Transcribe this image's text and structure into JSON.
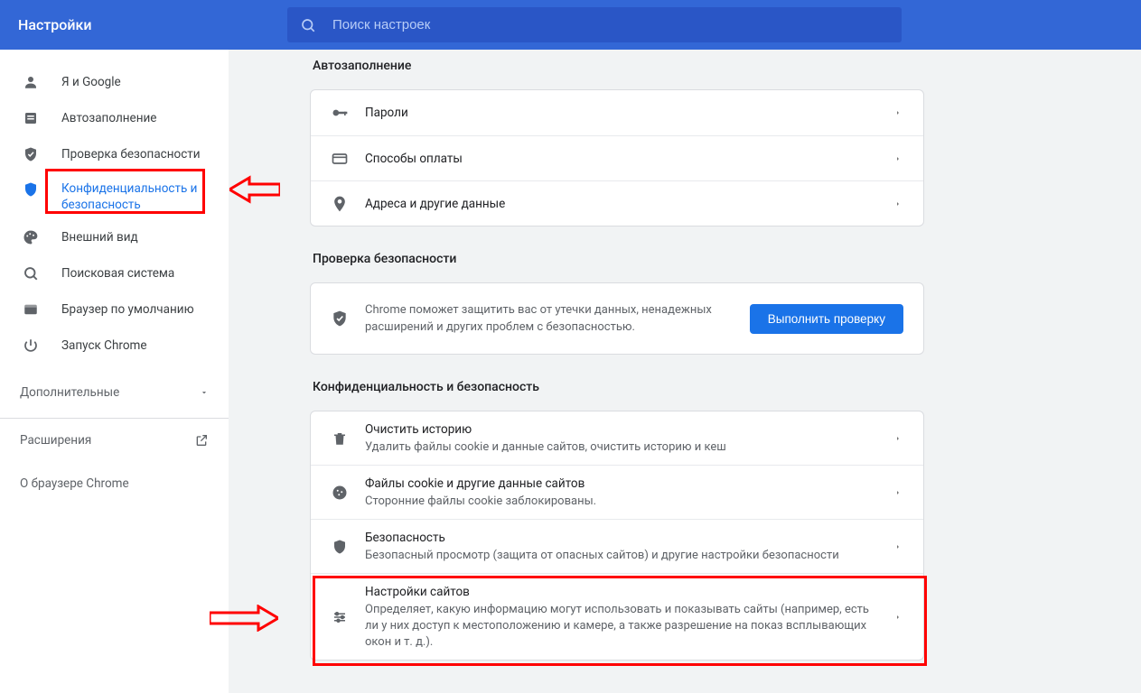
{
  "header": {
    "title": "Настройки",
    "search_placeholder": "Поиск настроек"
  },
  "sidebar": {
    "items": [
      {
        "icon": "person",
        "label": "Я и Google"
      },
      {
        "icon": "autofill",
        "label": "Автозаполнение"
      },
      {
        "icon": "shieldcheck",
        "label": "Проверка безопасности"
      },
      {
        "icon": "shield",
        "label": "Конфиденциальность и безопасность"
      },
      {
        "icon": "palette",
        "label": "Внешний вид"
      },
      {
        "icon": "search",
        "label": "Поисковая система"
      },
      {
        "icon": "browser",
        "label": "Браузер по умолчанию"
      },
      {
        "icon": "power",
        "label": "Запуск Chrome"
      }
    ],
    "additional": "Дополнительные",
    "extensions": "Расширения",
    "about": "О браузере Chrome"
  },
  "main": {
    "autofill": {
      "title": "Автозаполнение",
      "rows": [
        {
          "icon": "key",
          "title": "Пароли"
        },
        {
          "icon": "card",
          "title": "Способы оплаты"
        },
        {
          "icon": "pin",
          "title": "Адреса и другие данные"
        }
      ]
    },
    "safety": {
      "title": "Проверка безопасности",
      "text": "Chrome поможет защитить вас от утечки данных, ненадежных расширений и других проблем с безопасностью.",
      "button": "Выполнить проверку"
    },
    "privacy": {
      "title": "Конфиденциальность и безопасность",
      "rows": [
        {
          "icon": "trash",
          "title": "Очистить историю",
          "sub": "Удалить файлы cookie и данные сайтов, очистить историю и кеш"
        },
        {
          "icon": "cookie",
          "title": "Файлы cookie и другие данные сайтов",
          "sub": "Сторонние файлы cookie заблокированы."
        },
        {
          "icon": "shield",
          "title": "Безопасность",
          "sub": "Безопасный просмотр (защита от опасных сайтов) и другие настройки безопасности"
        },
        {
          "icon": "sliders",
          "title": "Настройки сайтов",
          "sub": "Определяет, какую информацию могут использовать и показывать сайты (например, есть ли у них доступ к местоположению и камере, а также разрешение на показ всплывающих окон и т. д.)."
        }
      ]
    }
  }
}
